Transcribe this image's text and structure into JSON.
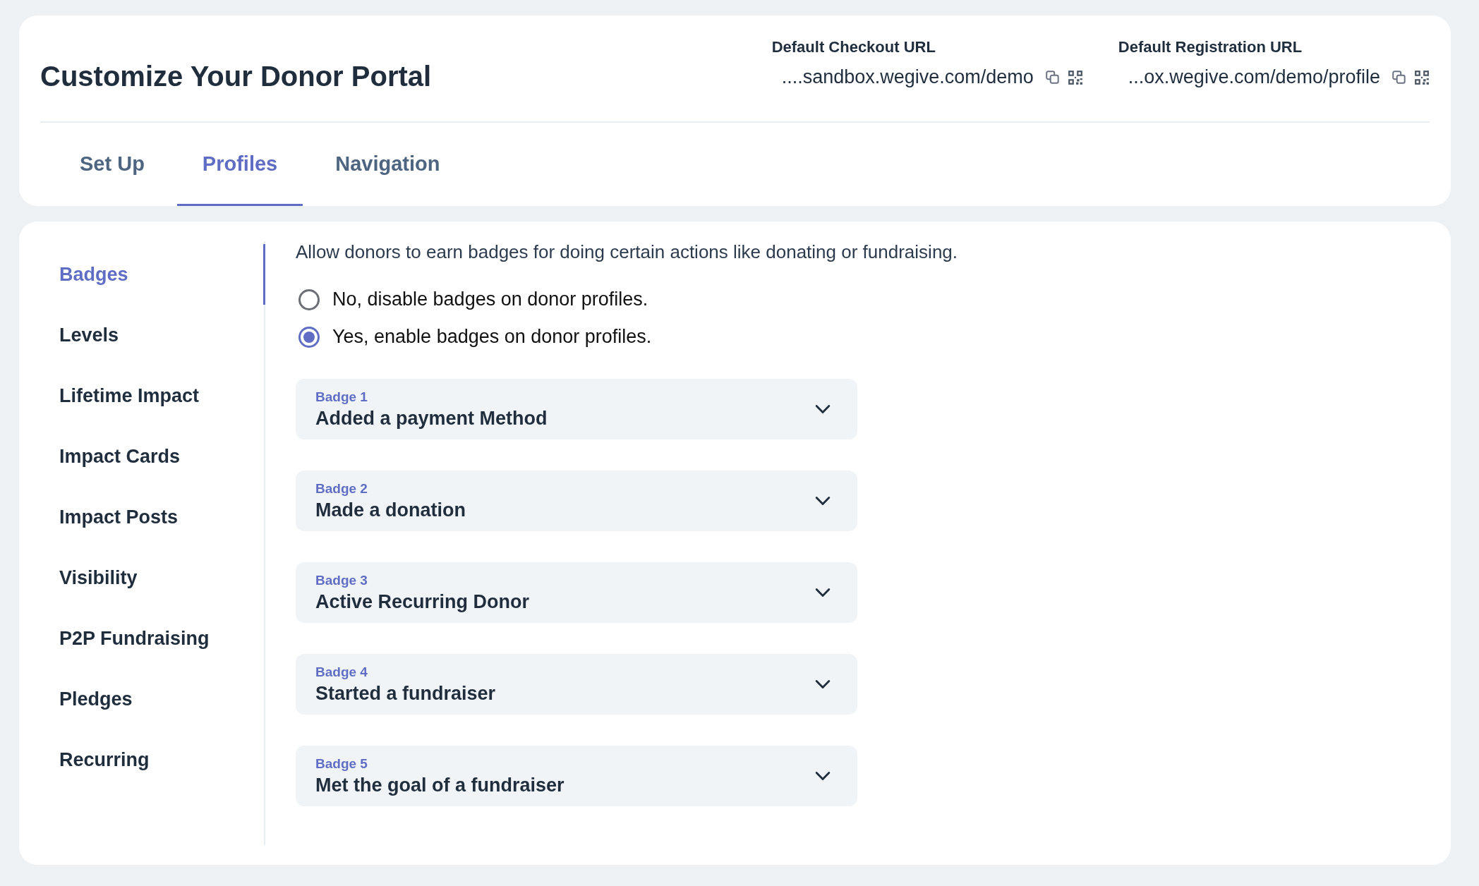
{
  "header": {
    "title": "Customize Your Donor Portal",
    "urls": [
      {
        "label": "Default Checkout URL",
        "value": "....sandbox.wegive.com/demo"
      },
      {
        "label": "Default Registration URL",
        "value": "...ox.wegive.com/demo/profile"
      }
    ]
  },
  "tabs": [
    {
      "label": "Set Up",
      "selected": false
    },
    {
      "label": "Profiles",
      "selected": true
    },
    {
      "label": "Navigation",
      "selected": false
    }
  ],
  "sidebar": {
    "items": [
      {
        "label": "Badges",
        "selected": true
      },
      {
        "label": "Levels",
        "selected": false
      },
      {
        "label": "Lifetime Impact",
        "selected": false
      },
      {
        "label": "Impact Cards",
        "selected": false
      },
      {
        "label": "Impact Posts",
        "selected": false
      },
      {
        "label": "Visibility",
        "selected": false
      },
      {
        "label": "P2P Fundraising",
        "selected": false
      },
      {
        "label": "Pledges",
        "selected": false
      },
      {
        "label": "Recurring",
        "selected": false
      }
    ]
  },
  "description": "Allow donors to earn badges for doing certain actions like donating or fundraising.",
  "options": [
    {
      "label": "No, disable badges on donor profiles.",
      "selected": false
    },
    {
      "label": "Yes, enable badges on donor profiles.",
      "selected": true
    }
  ],
  "badges": [
    {
      "label": "Badge 1",
      "title": "Added a payment Method",
      "expanded": false
    },
    {
      "label": "Badge 2",
      "title": "Made a donation",
      "expanded": false
    },
    {
      "label": "Badge 3",
      "title": "Active Recurring Donor",
      "expanded": false
    },
    {
      "label": "Badge 4",
      "title": "Started a fundraiser",
      "expanded": false
    },
    {
      "label": "Badge 5",
      "title": "Met the goal of a fundraiser",
      "expanded": false
    }
  ]
}
